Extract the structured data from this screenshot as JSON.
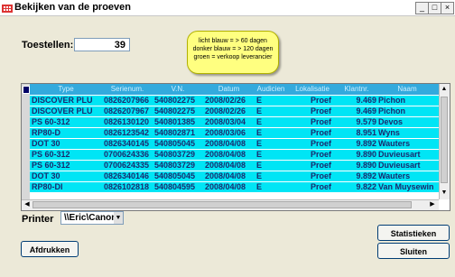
{
  "window": {
    "title": "Bekijken van de proeven",
    "controls": [
      "_",
      "□",
      "×"
    ]
  },
  "toestellen": {
    "label": "Toestellen:",
    "value": "39"
  },
  "legend_tooltip": {
    "lines": [
      "licht blauw = > 60 dagen",
      "donker blauw = > 120 dagen",
      "groen = verkoop leverancier"
    ]
  },
  "table": {
    "columns": [
      "Type",
      "Serienum.",
      "V.N.",
      "Datum",
      "Audicien",
      "Lokalisatie",
      "Klantnr.",
      "Naam"
    ],
    "rows": [
      [
        "DISCOVER PLU",
        "0826207966",
        "540802275",
        "2008/02/26",
        "E",
        "Proef",
        "9.469",
        "Pichon"
      ],
      [
        "DISCOVER PLU",
        "0826207967",
        "540802275",
        "2008/02/26",
        "E",
        "Proef",
        "9.469",
        "Pichon"
      ],
      [
        "PS 60-312",
        "0826130120",
        "540801385",
        "2008/03/04",
        "E",
        "Proef",
        "9.579",
        "Devos"
      ],
      [
        "RP80-D",
        "0826123542",
        "540802871",
        "2008/03/06",
        "E",
        "Proef",
        "8.951",
        "Wyns"
      ],
      [
        "DOT 30",
        "0826340145",
        "540805045",
        "2008/04/08",
        "E",
        "Proef",
        "9.892",
        "Wauters"
      ],
      [
        "PS 60-312",
        "0700624336",
        "540803729",
        "2008/04/08",
        "E",
        "Proef",
        "9.890",
        "Duvieusart"
      ],
      [
        "PS 60-312",
        "0700624335",
        "540803729",
        "2008/04/08",
        "E",
        "Proef",
        "9.890",
        "Duvieusart"
      ],
      [
        "DOT 30",
        "0826340146",
        "540805045",
        "2008/04/08",
        "E",
        "Proef",
        "9.892",
        "Wauters"
      ],
      [
        "RP80-DI",
        "0826102818",
        "540804595",
        "2008/04/08",
        "E",
        "Proef",
        "9.822",
        "Van Muysewink"
      ]
    ],
    "row_color": "#00e5f5"
  },
  "printer": {
    "label": "Printer",
    "selected": "\\\\Eric\\Canon"
  },
  "buttons": {
    "print": "Afdrukken",
    "stats": "Statistieken",
    "close": "Sluiten"
  }
}
